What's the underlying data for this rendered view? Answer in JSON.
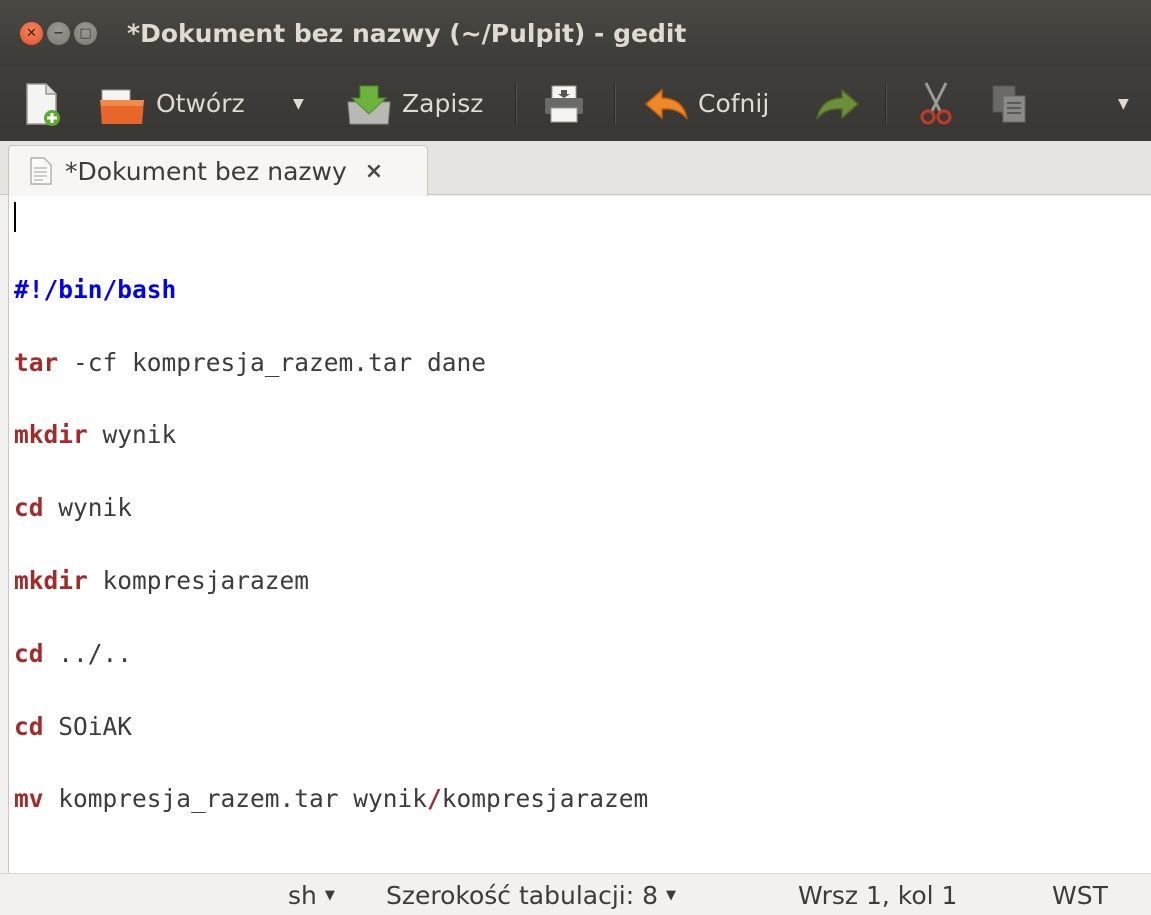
{
  "window": {
    "title": "*Dokument bez nazwy (~/Pulpit) - gedit"
  },
  "toolbar": {
    "open_label": "Otwórz",
    "save_label": "Zapisz",
    "undo_label": "Cofnij"
  },
  "tab": {
    "label": "*Dokument bez nazwy",
    "close": "×"
  },
  "editor": {
    "lines": [
      {
        "kw": "",
        "rest": "",
        "shebang": "#!/bin/bash"
      },
      {
        "kw": "tar",
        "rest": " -cf kompresja_razem.tar dane"
      },
      {
        "kw": "mkdir",
        "rest": " wynik"
      },
      {
        "kw": "cd",
        "rest": " wynik"
      },
      {
        "kw": "mkdir",
        "rest": " kompresjarazem"
      },
      {
        "kw": "cd",
        "rest": " ../.."
      },
      {
        "kw": "cd",
        "rest": " SOiAK"
      },
      {
        "kw": "mv",
        "rest_a": " kompresja_razem.tar wynik",
        "slash": "/",
        "rest_b": "kompresjarazem"
      }
    ]
  },
  "statusbar": {
    "language": "sh",
    "tab_width": "Szerokość tabulacji: 8",
    "position": "Wrsz 1, kol 1",
    "mode": "WST"
  },
  "colors": {
    "keyword": "#a52a2a",
    "shebang": "#0000ff",
    "titlebar": "#3c3b37",
    "close_button": "#e0542c"
  }
}
